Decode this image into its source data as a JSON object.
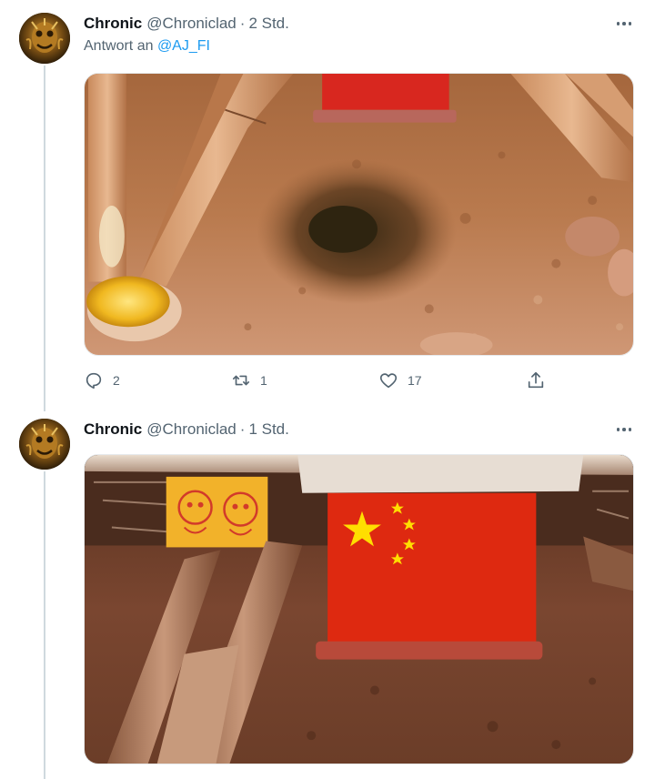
{
  "tweets": [
    {
      "author_name": "Chronic",
      "author_handle": "@Chroniclad",
      "separator": "·",
      "time": "2 Std.",
      "reply_prefix": "Antwort an",
      "reply_handle": "@AJ_FI",
      "stats": {
        "replies": "2",
        "retweets": "1",
        "likes": "17"
      }
    },
    {
      "author_name": "Chronic",
      "author_handle": "@Chroniclad",
      "separator": "·",
      "time": "1 Std."
    }
  ],
  "icons": {
    "reply": "comment-icon",
    "retweet": "retweet-icon",
    "like": "heart-icon",
    "share": "share-icon",
    "more": "more-dots-icon"
  },
  "colors": {
    "accent": "#1d9bf0",
    "secondary_text": "#536471",
    "thread_line": "#cfd9de",
    "flag_red": "#de2910",
    "flag_star": "#ffde00"
  }
}
